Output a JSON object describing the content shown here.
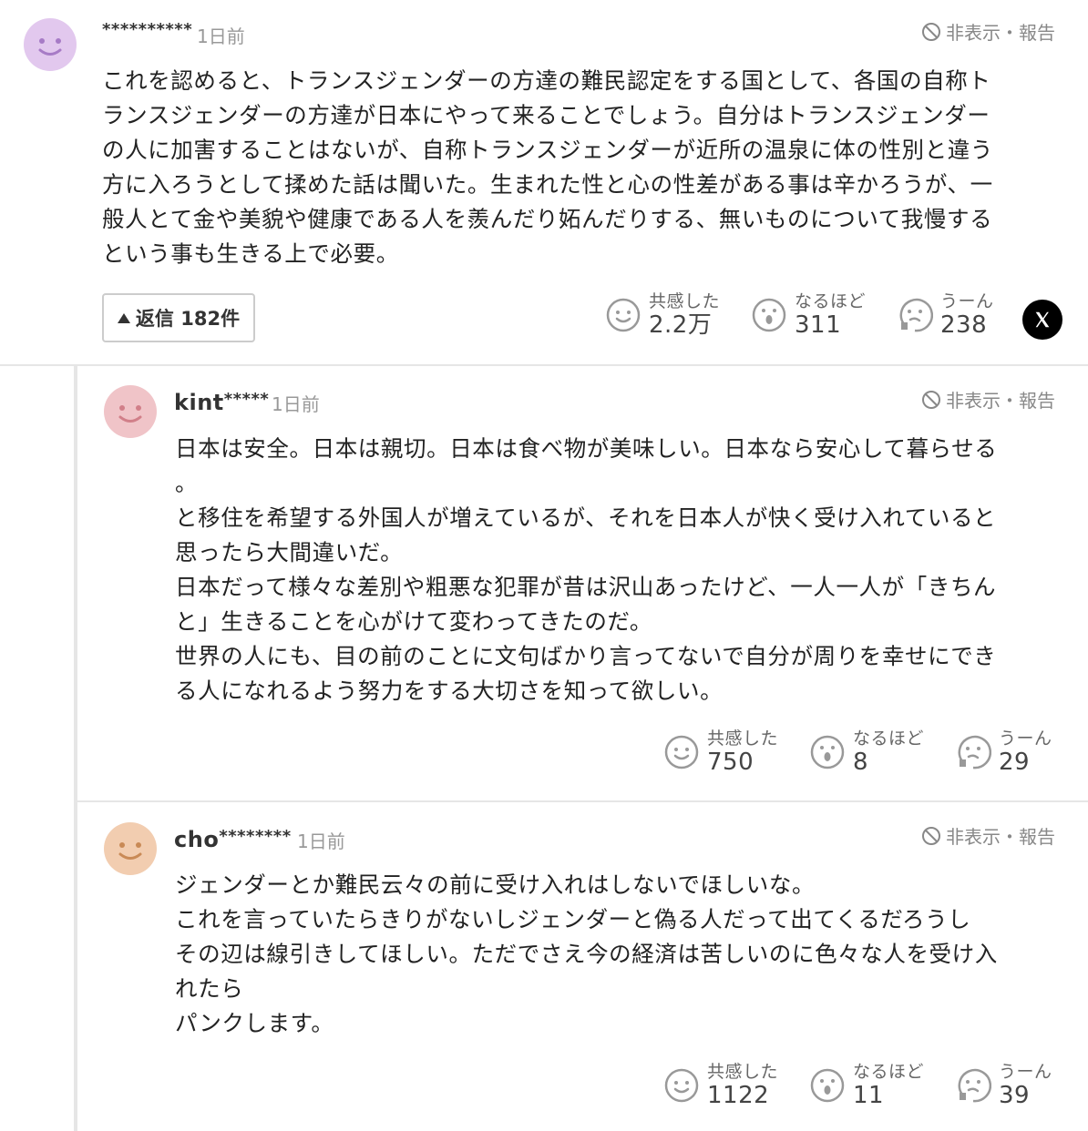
{
  "comment": {
    "username": "**********",
    "time": "1日前",
    "hide_report": "非表示・報告",
    "text": "これを認めると、トランスジェンダーの方達の難民認定をする国として、各国の自称ト\nランスジェンダーの方達が日本にやって来ることでしょう。自分はトランスジェンダー\nの人に加害することはないが、自称トランスジェンダーが近所の温泉に体の性別と違う\n方に入ろうとして揉めた話は聞いた。生まれた性と心の性差がある事は辛かろうが、一\n般人とて金や美貌や健康である人を羨んだり妬んだりする、無いものについて我慢する\nという事も生きる上で必要。",
    "reply_label": "返信 182件",
    "reactions": [
      {
        "icon": "smile-icon",
        "label": "共感した",
        "count": "2.2万"
      },
      {
        "icon": "surprised-icon",
        "label": "なるほど",
        "count": "311"
      },
      {
        "icon": "thinking-icon",
        "label": "うーん",
        "count": "238"
      }
    ],
    "share_icon": "x-logo-icon",
    "avatar_color": "#e2c8ee"
  },
  "replies": [
    {
      "username_prefix": "kint",
      "username_stars": "*****",
      "time": "1日前",
      "hide_report": "非表示・報告",
      "text": "日本は安全。日本は親切。日本は食べ物が美味しい。日本なら安心して暮らせる\n。\nと移住を希望する外国人が増えているが、それを日本人が快く受け入れていると\n思ったら大間違いだ。\n日本だって様々な差別や粗悪な犯罪が昔は沢山あったけど、一人一人が「きちん\nと」生きることを心がけて変わってきたのだ。\n世界の人にも、目の前のことに文句ばかり言ってないで自分が周りを幸せにでき\nる人になれるよう努力をする大切さを知って欲しい。",
      "reactions": [
        {
          "icon": "smile-icon",
          "label": "共感した",
          "count": "750"
        },
        {
          "icon": "surprised-icon",
          "label": "なるほど",
          "count": "8"
        },
        {
          "icon": "thinking-icon",
          "label": "うーん",
          "count": "29"
        }
      ],
      "avatar_color": "#f0c4c8"
    },
    {
      "username_prefix": "cho",
      "username_stars": "********",
      "time": "1日前",
      "hide_report": "非表示・報告",
      "text": "ジェンダーとか難民云々の前に受け入れはしないでほしいな。\nこれを言っていたらきりがないしジェンダーと偽る人だって出てくるだろうし\nその辺は線引きしてほしい。ただでさえ今の経済は苦しいのに色々な人を受け入\nれたら\nパンクします。",
      "reactions": [
        {
          "icon": "smile-icon",
          "label": "共感した",
          "count": "1122"
        },
        {
          "icon": "surprised-icon",
          "label": "なるほど",
          "count": "11"
        },
        {
          "icon": "thinking-icon",
          "label": "うーん",
          "count": "39"
        }
      ],
      "avatar_color": "#f2cdb0"
    }
  ]
}
